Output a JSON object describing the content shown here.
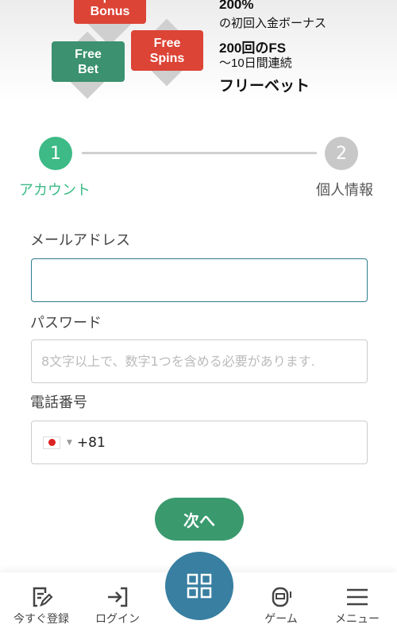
{
  "banner": {
    "deposit_bonus": "Deposit\nBonus",
    "free_spins": [
      "Free",
      "Spins"
    ],
    "free_bet": [
      "Free",
      "Bet"
    ],
    "line1": "200%",
    "line2": "の初回入金ボーナス",
    "line3": "200回のFS",
    "line4": "〜10日間連続",
    "line5": "フリーベット"
  },
  "stepper": {
    "steps": [
      {
        "num": "1",
        "label": "アカウント",
        "active": true
      },
      {
        "num": "2",
        "label": "個人情報",
        "active": false
      }
    ]
  },
  "form": {
    "email_label": "メールアドレス",
    "email_value": "",
    "password_label": "パスワード",
    "password_placeholder": "8文字以上で、数字1つを含める必要があります.",
    "phone_label": "電話番号",
    "phone_code": "+81",
    "phone_country": "JP"
  },
  "next_button": "次へ",
  "nav": {
    "items": [
      {
        "label": "今すぐ登録",
        "icon": "register-icon"
      },
      {
        "label": "ログイン",
        "icon": "login-icon"
      },
      {
        "label": "",
        "icon": "grid-icon"
      },
      {
        "label": "ゲーム",
        "icon": "slot-machine-icon"
      },
      {
        "label": "メニュー",
        "icon": "menu-icon"
      }
    ]
  },
  "colors": {
    "accent_green": "#3dba86",
    "button_green": "#3a9a6e",
    "nav_center": "#387fa1",
    "red": "#dc4436"
  }
}
